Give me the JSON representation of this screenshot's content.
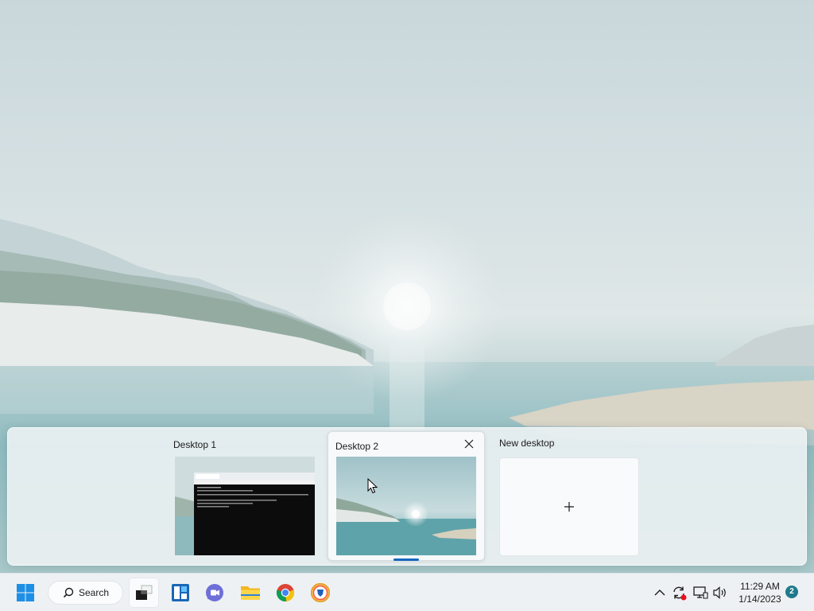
{
  "task_view": {
    "desktops": [
      {
        "label": "Desktop 1"
      },
      {
        "label": "Desktop 2"
      },
      {
        "label": "New desktop"
      }
    ],
    "new_desktop_icon": "plus-icon",
    "close_icon": "close-icon"
  },
  "taskbar": {
    "start_icon": "windows-start-icon",
    "search_label": "Search",
    "apps": [
      {
        "name": "task-view-icon",
        "active": true
      },
      {
        "name": "widgets-icon"
      },
      {
        "name": "teams-chat-icon"
      },
      {
        "name": "file-explorer-icon"
      },
      {
        "name": "chrome-icon"
      },
      {
        "name": "brave-icon"
      }
    ],
    "tray": {
      "icons": [
        "chevron-up-icon",
        "sync-icon",
        "network-icon",
        "volume-icon"
      ],
      "time": "11:29 AM",
      "date": "1/14/2023",
      "notification_count": "2"
    }
  },
  "colors": {
    "accent": "#1767c0",
    "taskbar_bg": "#eef1f3",
    "badge": "#1f7a8c"
  }
}
